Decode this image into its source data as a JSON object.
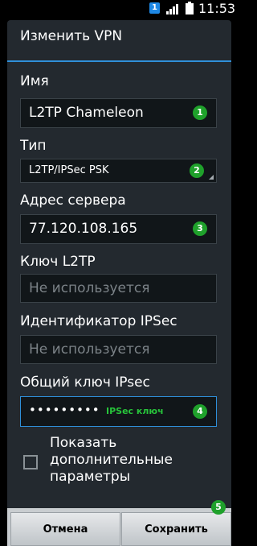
{
  "status_bar": {
    "notification_count": "1",
    "time": "11:53"
  },
  "dialog": {
    "title": "Изменить VPN"
  },
  "fields": {
    "name": {
      "label": "Имя",
      "value": "L2TP Chameleon",
      "badge": "1"
    },
    "type": {
      "label": "Тип",
      "value": "L2TP/IPSec PSK",
      "badge": "2"
    },
    "server": {
      "label": "Адрес сервера",
      "value": "77.120.108.165",
      "badge": "3"
    },
    "l2tp_key": {
      "label": "Ключ L2TP",
      "placeholder": "Не используется"
    },
    "ipsec_id": {
      "label": "Идентификатор IPSec",
      "placeholder": "Не используется"
    },
    "ipsec_shared_key": {
      "label": "Общий ключ IPsec",
      "value": "•••••••••",
      "hint": "IPSec ключ",
      "badge": "4"
    }
  },
  "advanced": {
    "checkbox_label": "Показать дополнительные параметры",
    "checked": false
  },
  "buttons": {
    "cancel_label": "Отмена",
    "save_label": "Сохранить",
    "save_badge": "5"
  },
  "colors": {
    "accent": "#2f8fd9",
    "badge": "#1fa12b",
    "hint": "#27c33a",
    "dialog_bg": "#23292f"
  },
  "icons": {
    "signal": "signal-icon",
    "battery": "battery-icon",
    "notification": "notification-icon"
  }
}
